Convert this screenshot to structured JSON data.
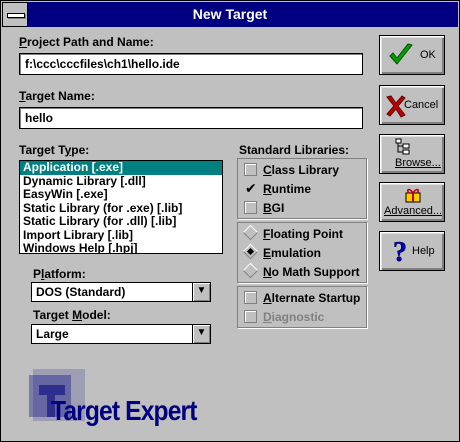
{
  "window": {
    "title": "New Target"
  },
  "project_path": {
    "label_u": "P",
    "label_rest": "roject Path and Name:",
    "value": "f:\\ccc\\cccfiles\\ch1\\hello.ide"
  },
  "target_name": {
    "label_u": "T",
    "label_rest": "arget Name:",
    "value": "hello"
  },
  "target_type": {
    "label_pre": "Target T",
    "label_u": "y",
    "label_rest": "pe:",
    "items": [
      "Application [.exe]",
      "Dynamic Library [.dll]",
      "EasyWin [.exe]",
      "Static Library (for .exe) [.lib]",
      "Static Library (for .dll) [.lib]",
      "Import Library [.lib]",
      "Windows Help [.hpj]"
    ],
    "selected_index": 0
  },
  "platform": {
    "label_pre": "P",
    "label_u": "l",
    "label_rest": "atform:",
    "value": "DOS (Standard)"
  },
  "target_model": {
    "label_pre": "Target ",
    "label_u": "M",
    "label_rest": "odel:",
    "value": "Large"
  },
  "standard_libraries": {
    "label": "Standard Libraries:",
    "class_library": {
      "u": "C",
      "rest": "lass Library",
      "checked": false
    },
    "runtime": {
      "u": "R",
      "rest": "untime",
      "checked": true
    },
    "bgi": {
      "u": "B",
      "rest": "GI",
      "checked": false
    },
    "floating_point": {
      "u": "F",
      "rest": "loating Point",
      "selected": false
    },
    "emulation": {
      "u": "E",
      "rest": "mulation",
      "selected": true
    },
    "no_math": {
      "u": "N",
      "rest": "o Math Support",
      "selected": false
    },
    "alternate_startup": {
      "u": "A",
      "rest": "lternate Startup",
      "checked": false
    },
    "diagnostic": {
      "u": "D",
      "rest": "iagnostic",
      "checked": false,
      "disabled": true
    }
  },
  "buttons": {
    "ok": "OK",
    "cancel": "Cancel",
    "browse": "Browse...",
    "advanced": "Advanced...",
    "help": "Help"
  },
  "logo": {
    "text": "Target Expert"
  },
  "colors": {
    "titlebar": "#000080",
    "selection": "#008080",
    "face": "#c0c0c0",
    "ok_check": "#00a000",
    "cancel_x": "#c00000",
    "help": "#0000c0"
  }
}
